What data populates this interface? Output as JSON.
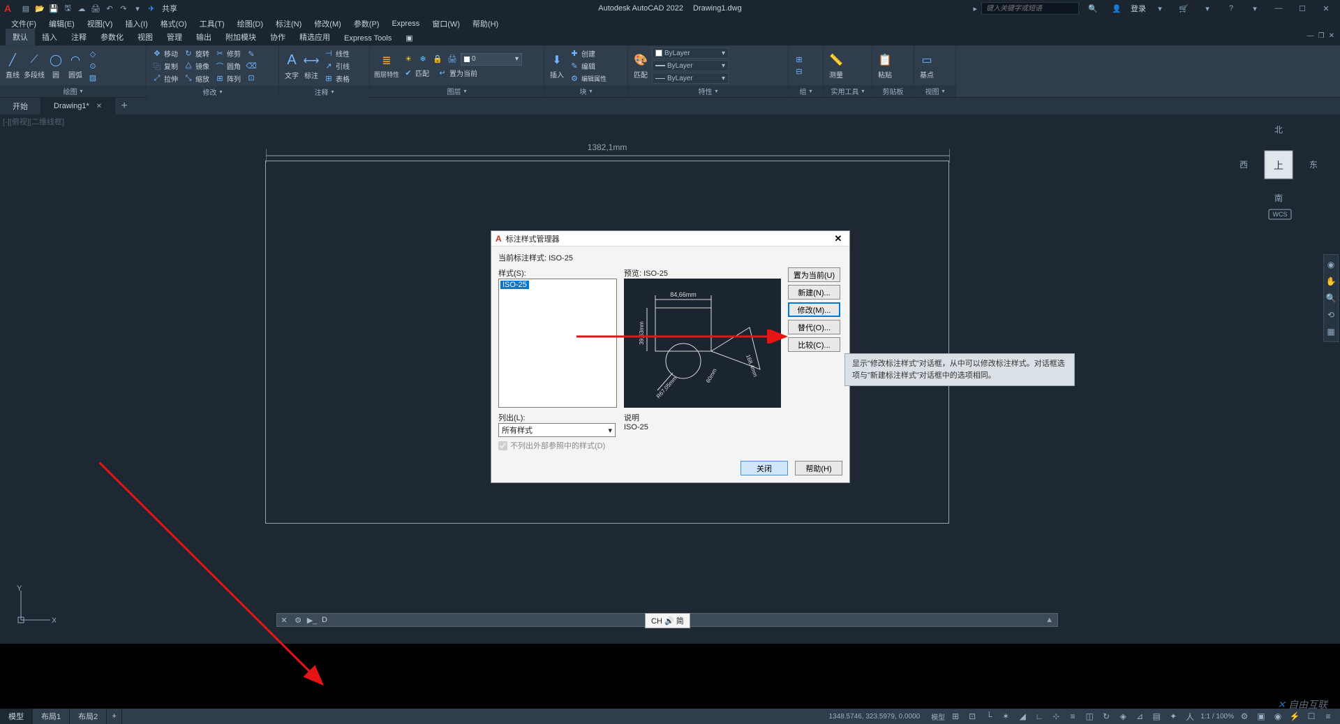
{
  "title": {
    "app": "Autodesk AutoCAD 2022",
    "file": "Drawing1.dwg"
  },
  "qat_share": "共享",
  "search_placeholder": "键入关键字或短语",
  "login": "登录",
  "menubar": [
    "文件(F)",
    "编辑(E)",
    "视图(V)",
    "插入(I)",
    "格式(O)",
    "工具(T)",
    "绘图(D)",
    "标注(N)",
    "修改(M)",
    "参数(P)",
    "Express",
    "窗口(W)",
    "帮助(H)"
  ],
  "ribbon_tabs": [
    "默认",
    "插入",
    "注释",
    "参数化",
    "视图",
    "管理",
    "输出",
    "附加模块",
    "协作",
    "精选应用",
    "Express Tools"
  ],
  "ribbon_tabs_active": 0,
  "panels": {
    "draw": {
      "title": "绘图",
      "items": [
        "直线",
        "多段线",
        "圆",
        "圆弧"
      ]
    },
    "modify": {
      "title": "修改",
      "small": [
        [
          "移动",
          "旋转",
          "修剪"
        ],
        [
          "复制",
          "镜像",
          "圆角"
        ],
        [
          "拉伸",
          "缩放",
          "阵列"
        ]
      ]
    },
    "annotate": {
      "title": "注释",
      "items": [
        "文字",
        "标注"
      ],
      "small": [
        "线性",
        "引线",
        "表格"
      ]
    },
    "layers": {
      "title": "图层",
      "btn": "图层特性",
      "combo": "0",
      "small": [
        "匹配",
        "置为当前"
      ]
    },
    "block": {
      "title": "块",
      "items": [
        "插入"
      ],
      "small": [
        "创建",
        "编辑",
        "编辑属性"
      ]
    },
    "props": {
      "title": "特性",
      "combos": [
        "ByLayer",
        "ByLayer",
        "ByLayer"
      ],
      "btn": "匹配"
    },
    "group": {
      "title": "组"
    },
    "utils": {
      "title": "实用工具",
      "btn": "测量"
    },
    "clip": {
      "title": "剪贴板",
      "btn": "粘贴"
    },
    "view": {
      "title": "视图",
      "btn": "基点"
    }
  },
  "filetabs": {
    "start": "开始",
    "active": "Drawing1*"
  },
  "viewport_label": "[-][俯视][二维线框]",
  "viewcube": {
    "n": "北",
    "s": "南",
    "e": "东",
    "w": "西",
    "top": "上",
    "wcs": "WCS"
  },
  "dimension_top": "1382,1mm",
  "ucs": {
    "x": "X",
    "y": "Y"
  },
  "dialog": {
    "title": "标注样式管理器",
    "current_label": "当前标注样式:",
    "current_value": "ISO-25",
    "styles_label": "样式(S):",
    "styles_selected": "ISO-25",
    "preview_label": "预览:",
    "preview_value": "ISO-25",
    "preview_dims": {
      "top": "84,66mm",
      "left": "39,63mm",
      "diag1": "R67,05mm",
      "diag2": "60mm",
      "diag3": "168,4mm"
    },
    "list_label": "列出(L):",
    "list_value": "所有样式",
    "checkbox": "不列出外部参照中的样式(D)",
    "desc_label": "说明",
    "desc_value": "ISO-25",
    "buttons": {
      "set_current": "置为当前(U)",
      "new": "新建(N)...",
      "modify": "修改(M)...",
      "override": "替代(O)...",
      "compare": "比较(C)..."
    },
    "close": "关闭",
    "help": "帮助(H)"
  },
  "tooltip": "显示\"修改标注样式\"对话框，从中可以修改标注样式。对话框选项与\"新建标注样式\"对话框中的选项相同。",
  "cmdline": {
    "prompt": "D",
    "ime": "CH 🔊 简"
  },
  "layout_tabs": [
    "模型",
    "布局1",
    "布局2"
  ],
  "status": {
    "coords": "1348.5746, 323.5979, 0.0000",
    "model": "模型",
    "scale": "1:1 / 100%"
  },
  "watermark": "自由互联"
}
